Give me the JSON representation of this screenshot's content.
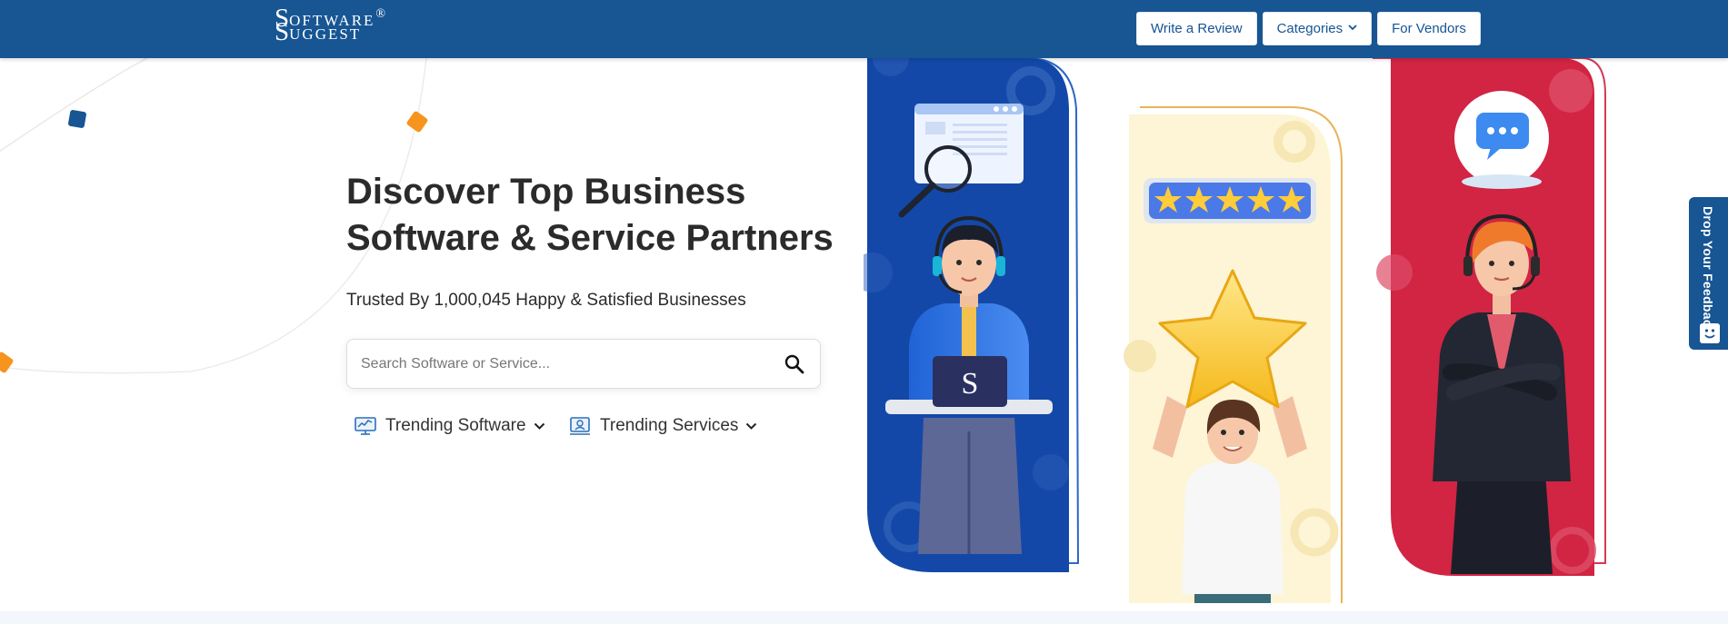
{
  "header": {
    "logo": {
      "s1": "S",
      "w1": "OFTWARE",
      "reg": "®",
      "s2": "S",
      "w2": "UGGEST"
    },
    "nav": {
      "write_review": "Write a Review",
      "categories": "Categories",
      "vendors": "For Vendors"
    }
  },
  "hero": {
    "title_line1": "Discover Top Business",
    "title_line2": "Software & Service Partners",
    "subtitle": "Trusted By 1,000,045 Happy & Satisfied Businesses",
    "search": {
      "placeholder": "Search Software or Service..."
    },
    "trending_software": "Trending Software",
    "trending_services": "Trending Services"
  },
  "illustrations": {
    "laptop_letter": "S"
  },
  "feedback": {
    "label": "Drop Your Feedback"
  },
  "colors": {
    "brand": "#175593",
    "blue_panel": "#1448a8",
    "cream_panel": "#fdf5d6",
    "red_panel": "#d22443",
    "accent_orange": "#f7941d"
  },
  "icons": {
    "search": "search-icon",
    "chevron": "chevron-down-icon",
    "software": "monitor-chart-icon",
    "services": "service-desk-icon",
    "feedback": "smile-chat-icon"
  }
}
